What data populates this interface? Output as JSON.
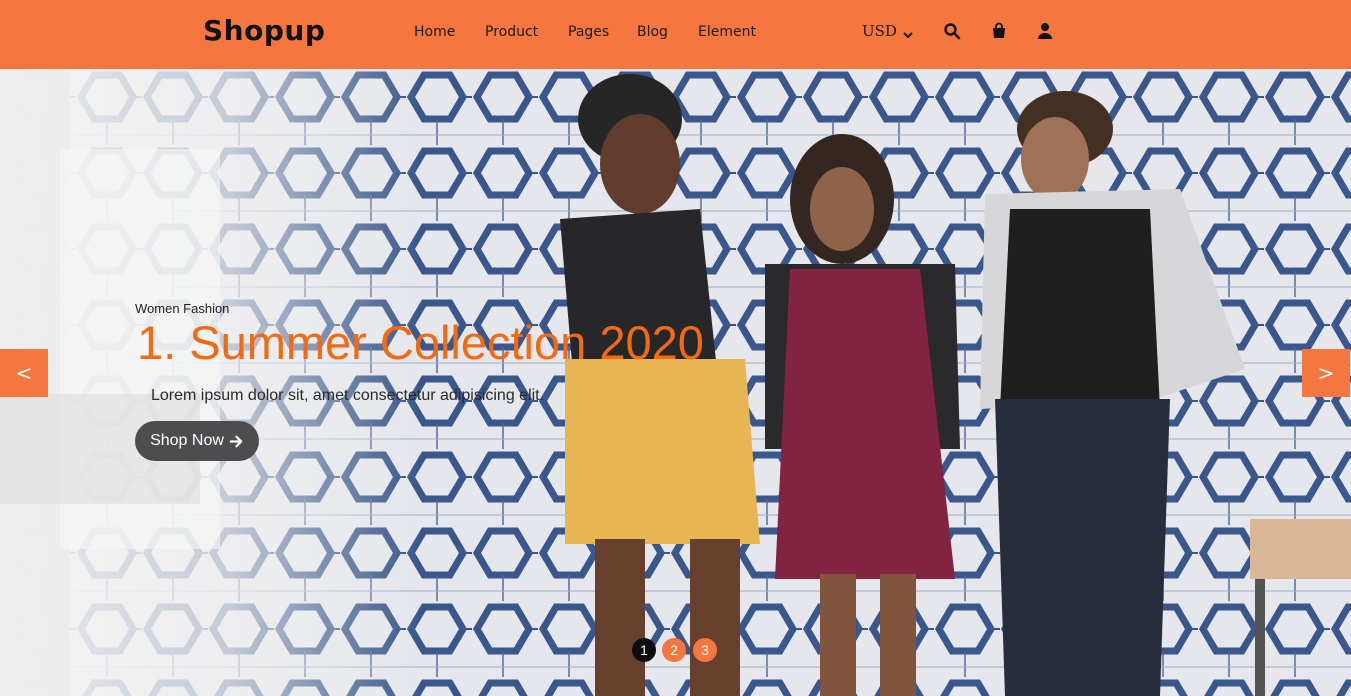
{
  "brand": {
    "name": "Shopup"
  },
  "nav": {
    "items": [
      {
        "label": "Home"
      },
      {
        "label": "Product"
      },
      {
        "label": "Pages"
      },
      {
        "label": "Blog"
      },
      {
        "label": "Element"
      }
    ]
  },
  "header_tools": {
    "currency": "USD",
    "icons": [
      "chevron-down-icon",
      "search-icon",
      "shopping-bag-icon",
      "user-icon"
    ]
  },
  "hero": {
    "eyebrow": "Women Fashion",
    "headline": "1. Summer Collection 2020",
    "description": "Lorem ipsum dolor sit, amet consectetur adipisicing elit.",
    "cta_label": "Shop Now",
    "cta_icon": "arrow-right-icon",
    "prev_label": "<",
    "next_label": ">",
    "slides": [
      {
        "number": "1",
        "active": true
      },
      {
        "number": "2",
        "active": false
      },
      {
        "number": "3",
        "active": false
      }
    ]
  },
  "colors": {
    "accent": "#f5763f",
    "headline": "#f36a10",
    "dot_active": "#0d0d0d",
    "button_dark": "#4d4d4f"
  }
}
